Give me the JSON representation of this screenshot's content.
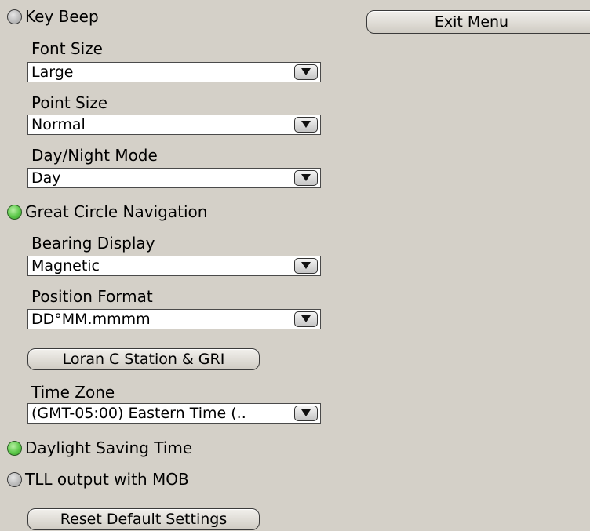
{
  "exit_menu": {
    "label": "Exit Menu"
  },
  "key_beep": {
    "label": "Key Beep",
    "enabled": false
  },
  "font_size": {
    "label": "Font Size",
    "value": "Large"
  },
  "point_size": {
    "label": "Point Size",
    "value": "Normal"
  },
  "day_night_mode": {
    "label": "Day/Night Mode",
    "value": "Day"
  },
  "great_circle_navigation": {
    "label": "Great Circle Navigation",
    "enabled": true
  },
  "bearing_display": {
    "label": "Bearing Display",
    "value": "Magnetic"
  },
  "position_format": {
    "label": "Position Format",
    "value": "DD°MM.mmmm"
  },
  "loran": {
    "label": "Loran C Station & GRI"
  },
  "time_zone": {
    "label": "Time Zone",
    "value": "(GMT-05:00) Eastern Time (.."
  },
  "daylight_saving_time": {
    "label": "Daylight Saving Time",
    "enabled": true
  },
  "tll_output_with_mob": {
    "label": "TLL output with MOB",
    "enabled": false
  },
  "reset": {
    "label": "Reset Default Settings"
  },
  "icons": {
    "toggle_off": "grey-led-icon",
    "toggle_on": "green-led-icon",
    "dropdown": "chevron-down-icon"
  },
  "colors": {
    "background": "#d4d0c8",
    "led_on": "#5cc84a",
    "led_off": "#b9b9b9",
    "field_background": "#ffffff"
  }
}
